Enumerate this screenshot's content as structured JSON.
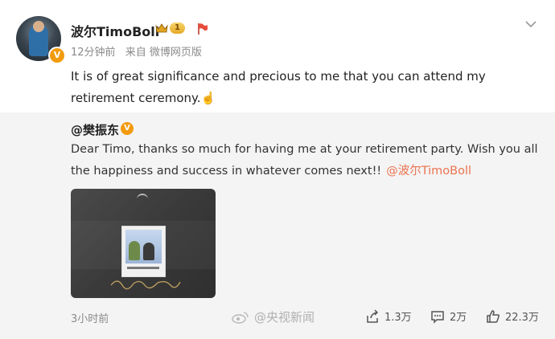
{
  "post": {
    "username": "波尔TimoBoll",
    "level": "1",
    "time": "12分钟前",
    "source": "来自 微博网页版",
    "text": "It is of great significance and precious to me that you can attend my retirement ceremony.☝️",
    "verified_badge": "V"
  },
  "repost": {
    "username": "@樊振东",
    "verified_badge": "V",
    "text": "Dear Timo, thanks so much for having me at your retirement party. Wish you all the happiness and success in whatever comes next!!",
    "mention": "@波尔TimoBoll",
    "time": "3小时前",
    "shares": "1.3万",
    "comments": "2万",
    "likes": "22.3万"
  },
  "watermark": "@央视新闻",
  "colors": {
    "accent_orange": "#eb7350",
    "verified": "#f29b0f",
    "repost_bg": "#f4f4f4",
    "meta_gray": "#8a8a8a"
  }
}
